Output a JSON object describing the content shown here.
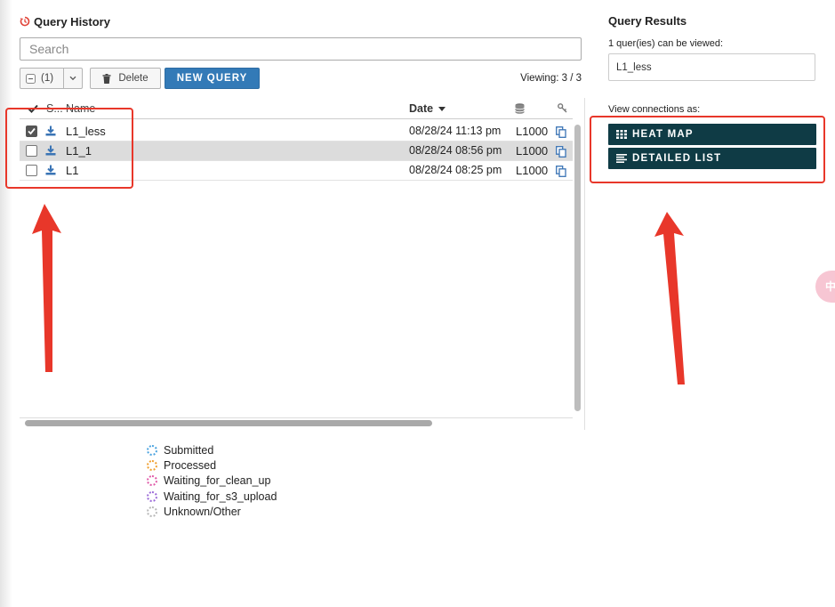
{
  "query_history": {
    "title": "Query History",
    "search_placeholder": "Search",
    "selection_count": "(1)",
    "delete_label": "Delete",
    "new_query_label": "NEW QUERY",
    "viewing": "Viewing: 3 / 3",
    "columns": {
      "status": "S...",
      "name": "Name",
      "date": "Date"
    },
    "rows": [
      {
        "checked": true,
        "name": "L1_less",
        "date": "08/28/24 11:13 pm",
        "db": "L1000"
      },
      {
        "checked": false,
        "name": "L1_1",
        "date": "08/28/24 08:56 pm",
        "db": "L1000"
      },
      {
        "checked": false,
        "name": "L1",
        "date": "08/28/24 08:25 pm",
        "db": "L1000"
      }
    ]
  },
  "legend": [
    {
      "label": "Submitted",
      "color": "#4aa3df"
    },
    {
      "label": "Processed",
      "color": "#f0a030"
    },
    {
      "label": "Waiting_for_clean_up",
      "color": "#e05aa8"
    },
    {
      "label": "Waiting_for_s3_upload",
      "color": "#9b6ad8"
    },
    {
      "label": "Unknown/Other",
      "color": "#b8b8b8"
    }
  ],
  "query_results": {
    "title": "Query Results",
    "count_text": "1 quer(ies) can be viewed:",
    "selected_query": "L1_less",
    "view_as_label": "View connections as:",
    "heat_map_label": "HEAT MAP",
    "detailed_list_label": "DETAILED LIST"
  },
  "side_tab": "中",
  "colors": {
    "primary": "#337ab7",
    "dark_button": "#0f3b45",
    "annotation": "#e8372a"
  }
}
